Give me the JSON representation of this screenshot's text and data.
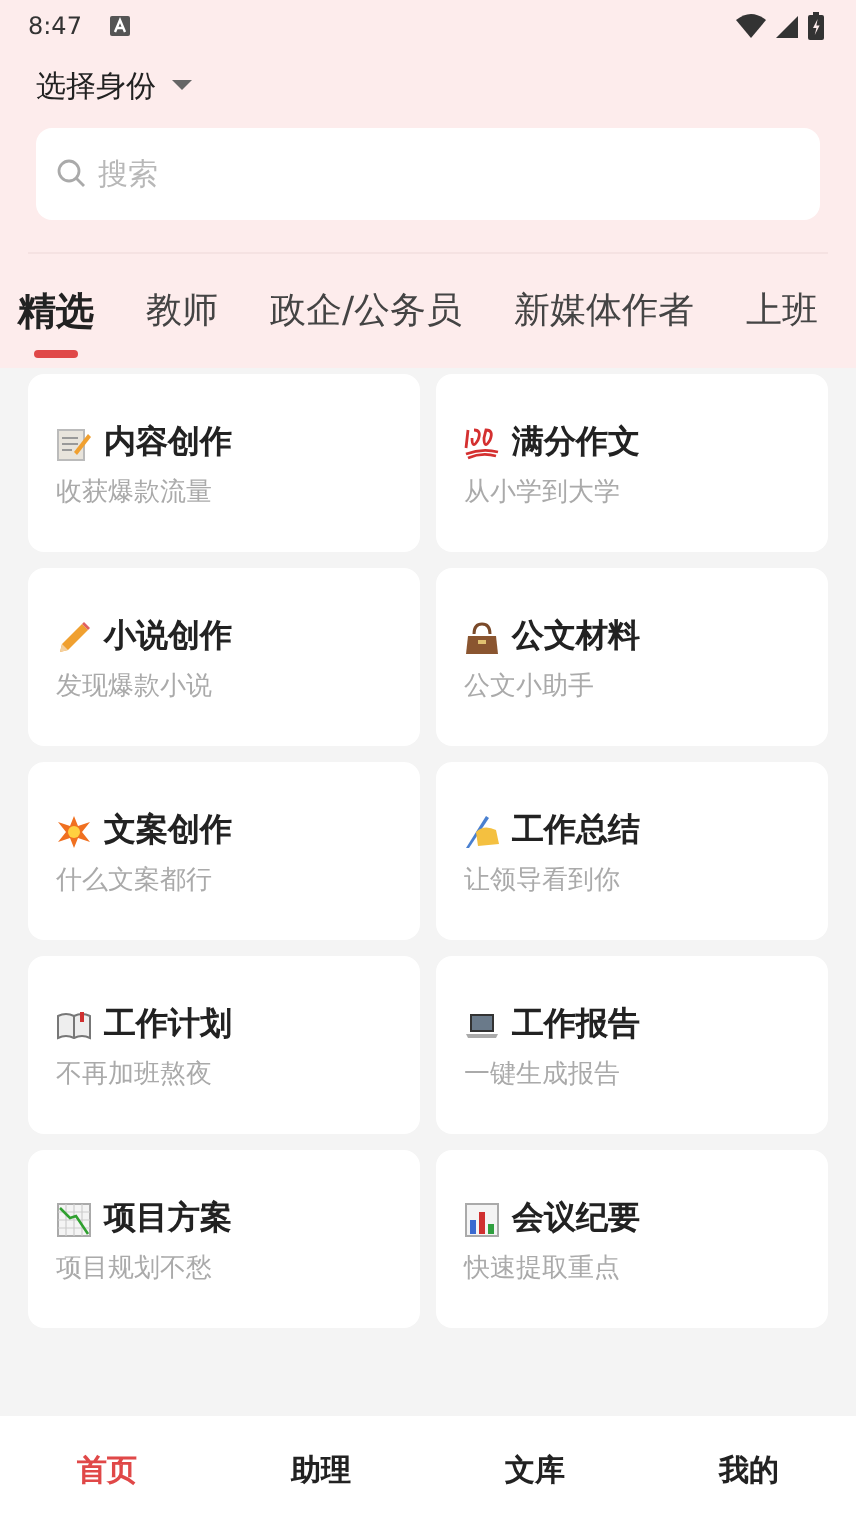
{
  "status_bar": {
    "time": "8:47"
  },
  "identity_selector": {
    "label": "选择身份"
  },
  "search": {
    "placeholder": "搜索"
  },
  "tabs": [
    {
      "label": "精选",
      "selected": true
    },
    {
      "label": "教师",
      "selected": false
    },
    {
      "label": "政企/公务员",
      "selected": false
    },
    {
      "label": "新媒体作者",
      "selected": false
    },
    {
      "label": "上班",
      "selected": false
    }
  ],
  "cards": [
    {
      "title": "内容创作",
      "subtitle": "收获爆款流量"
    },
    {
      "title": "满分作文",
      "subtitle": "从小学到大学"
    },
    {
      "title": "小说创作",
      "subtitle": "发现爆款小说"
    },
    {
      "title": "公文材料",
      "subtitle": "公文小助手"
    },
    {
      "title": "文案创作",
      "subtitle": "什么文案都行"
    },
    {
      "title": "工作总结",
      "subtitle": "让领导看到你"
    },
    {
      "title": "工作计划",
      "subtitle": "不再加班熬夜"
    },
    {
      "title": "工作报告",
      "subtitle": "一键生成报告"
    },
    {
      "title": "项目方案",
      "subtitle": "项目规划不愁"
    },
    {
      "title": "会议纪要",
      "subtitle": "快速提取重点"
    }
  ],
  "bottom_nav": [
    {
      "label": "首页",
      "selected": true
    },
    {
      "label": "助理",
      "selected": false
    },
    {
      "label": "文库",
      "selected": false
    },
    {
      "label": "我的",
      "selected": false
    }
  ]
}
